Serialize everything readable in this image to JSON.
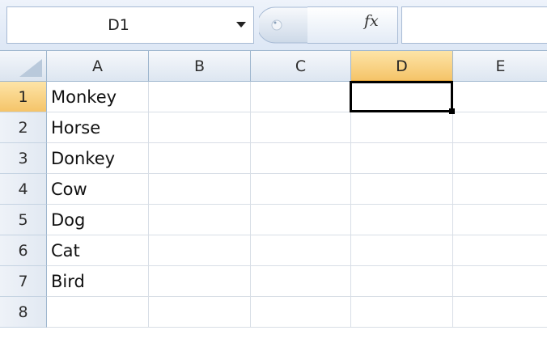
{
  "formula_bar": {
    "name_box_value": "D1",
    "fx_label": "fx",
    "formula_value": ""
  },
  "columns": [
    "A",
    "B",
    "C",
    "D",
    "E"
  ],
  "rows": [
    "1",
    "2",
    "3",
    "4",
    "5",
    "6",
    "7",
    "8"
  ],
  "selected_cell": "D1",
  "cells": {
    "A1": "Monkey",
    "A2": "Horse",
    "A3": "Donkey",
    "A4": "Cow",
    "A5": "Dog",
    "A6": "Cat",
    "A7": "Bird"
  },
  "colors": {
    "active_header": "#f5c469",
    "grid_line": "#d8dee6",
    "header_border": "#9eb6ce"
  }
}
